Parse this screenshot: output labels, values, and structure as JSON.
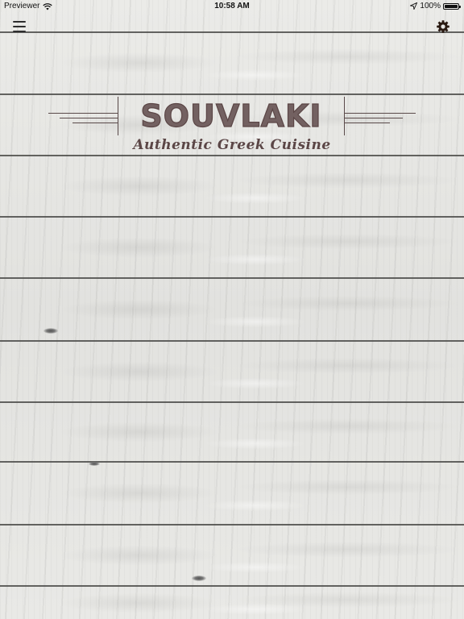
{
  "status_bar": {
    "carrier": "Previewer",
    "time": "10:58 AM",
    "battery": "100%",
    "icons": [
      "wifi-icon",
      "location-arrow-icon",
      "battery-icon"
    ]
  },
  "nav": {
    "menu_icon": "hamburger-menu-icon",
    "settings_icon": "gear-icon"
  },
  "logo": {
    "title": "SOUVLAKI",
    "subtitle": "Authentic Greek Cuisine"
  },
  "colors": {
    "logo": "#5b4646",
    "background": "#e6e6e3",
    "plank_seam": "#4a4a48"
  }
}
